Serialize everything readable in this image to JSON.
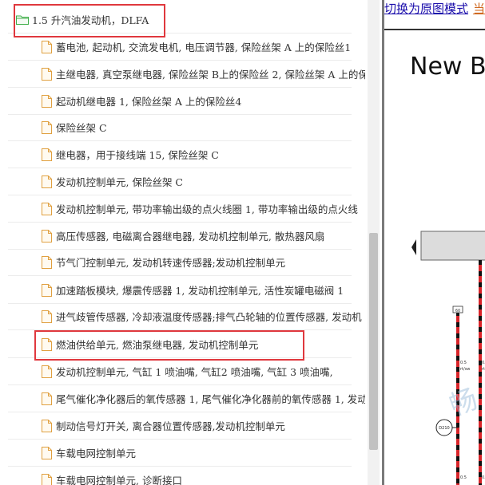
{
  "tree": {
    "root_label": "1.5 升汽油发动机，DLFA",
    "items": [
      {
        "label": "蓄电池, 起动机, 交流发电机, 电压调节器, 保险丝架 A 上的保险丝1"
      },
      {
        "label": "主继电器, 真空泵继电器, 保险丝架 B上的保险丝 2, 保险丝架 A 上的保"
      },
      {
        "label": "起动机继电器 1, 保险丝架 A 上的保险丝4"
      },
      {
        "label": "保险丝架 C"
      },
      {
        "label": "继电器，用于接线端 15, 保险丝架 C"
      },
      {
        "label": "发动机控制单元, 保险丝架 C"
      },
      {
        "label": "发动机控制单元, 带功率输出级的点火线圈 1, 带功率输出级的点火线"
      },
      {
        "label": "高压传感器, 电磁离合器继电器, 发动机控制单元, 散热器风扇"
      },
      {
        "label": "节气门控制单元, 发动机转速传感器;发动机控制单元"
      },
      {
        "label": "加速踏板模块, 爆震传感器 1, 发动机控制单元, 活性炭罐电磁阀 1"
      },
      {
        "label": "进气歧管传感器, 冷却液温度传感器;排气凸轮轴的位置传感器, 发动机"
      },
      {
        "label": "燃油供给单元, 燃油泵继电器, 发动机控制单元"
      },
      {
        "label": "发动机控制单元, 气缸 1 喷油嘴, 气缸2 喷油嘴, 气缸 3 喷油嘴,"
      },
      {
        "label": "尾气催化净化器后的氧传感器 1, 尾气催化净化器前的氧传感器 1, 发动"
      },
      {
        "label": "制动信号灯开关, 离合器位置传感器,发动机控制单元"
      },
      {
        "label": "车载电网控制单元"
      },
      {
        "label": "车载电网控制单元, 诊断接口"
      }
    ]
  },
  "right_panel": {
    "link_original_mode": "切换为原图模式",
    "link_second": "当",
    "diagram_title": "New B",
    "connector_label": "D210",
    "box_label": "60",
    "wire_label": "0.5",
    "wire_color_label": "rt/sw"
  },
  "colors": {
    "highlight": "#e0383e",
    "link": "#1a0dab",
    "wire_red": "#d9252a",
    "wire_black": "#111111",
    "folder_green": "#3fae49"
  }
}
